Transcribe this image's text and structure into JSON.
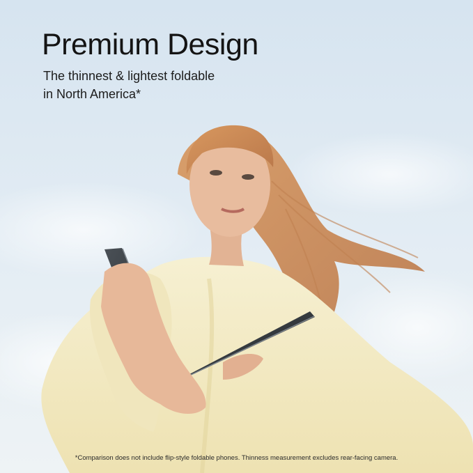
{
  "headline": "Premium Design",
  "subheadline": {
    "line1": "The thinnest & lightest foldable",
    "line2": "in North America*"
  },
  "footnote": "*Comparison does not include flip-style foldable phones. Thinness measurement excludes rear-facing camera.",
  "colors": {
    "sky_top": "#d8e6f1",
    "sky_bottom": "#e9f1f6",
    "sweater": "#f3ebc4",
    "hair": "#c98a55",
    "skin": "#e6b89a",
    "phone": "#2b2f33",
    "text": "#141414"
  }
}
